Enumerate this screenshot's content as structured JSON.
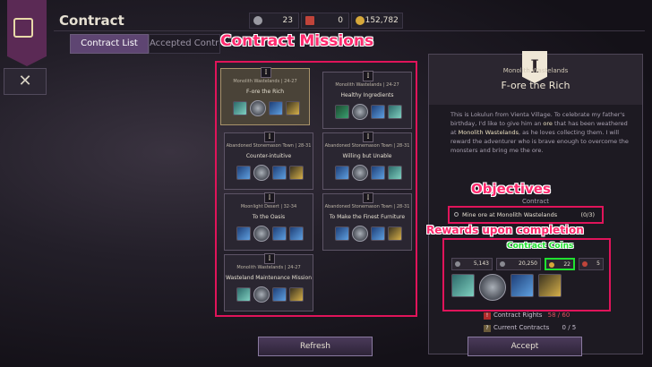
{
  "app": {
    "title": "Contract"
  },
  "currencies": [
    {
      "icon": "silver-coin-icon",
      "value": "23"
    },
    {
      "icon": "arrow-token-icon",
      "value": "0"
    },
    {
      "icon": "gold-coin-icon",
      "value": "5,152,782"
    }
  ],
  "tabs": [
    {
      "label": "Contract List",
      "active": true
    },
    {
      "label": "Accepted Contracts",
      "active": false
    }
  ],
  "annotations": {
    "missions": "Contract Missions",
    "objectives": "Objectives",
    "rewards": "Rewards upon completion",
    "coins": "Contract Coins"
  },
  "missions": [
    {
      "rank": "I",
      "region": "Monolith Wastelands",
      "level": "24-27",
      "title": "F-ore the Rich",
      "selected": true
    },
    {
      "rank": "I",
      "region": "Monolith Wastelands",
      "level": "24-27",
      "title": "Healthy Ingredients",
      "selected": false
    },
    {
      "rank": "I",
      "region": "Abandoned Stonemason Town",
      "level": "28-31",
      "title": "Counter-intuitive",
      "selected": false
    },
    {
      "rank": "I",
      "region": "Abandoned Stonemason Town",
      "level": "28-31",
      "title": "Willing but Unable",
      "selected": false
    },
    {
      "rank": "I",
      "region": "Moonlight Desert",
      "level": "32-34",
      "title": "To the Oasis",
      "selected": false
    },
    {
      "rank": "I",
      "region": "Abandoned Stonemason Town",
      "level": "28-31",
      "title": "To Make the Finest Furniture",
      "selected": false
    },
    {
      "rank": "I",
      "region": "Monolith Wastelands",
      "level": "24-27",
      "title": "Wasteland Maintenance Mission",
      "selected": false
    }
  ],
  "detail": {
    "rank": "I",
    "region": "Monolith Wastelands",
    "title": "F-ore the Rich",
    "desc_1": "This is Lokulun from Vienta Village. To celebrate my father's birthday, I'd like to give him an ",
    "desc_ore": "ore",
    "desc_2": " that has been weathered at ",
    "desc_place": "Monolith Wastelands",
    "desc_3": ", as he loves collecting them. I will reward the adventurer who is brave enough to overcome the monsters and bring me the ore.",
    "contract_label": "Contract",
    "objective": "Mine ore at Monolith Wastelands",
    "objective_count": "(0/3)",
    "rewards_label": "Co",
    "rewards": [
      {
        "icon": "exp-icon",
        "value": "5,143"
      },
      {
        "icon": "silver-icon",
        "value": "20,250"
      },
      {
        "icon": "contract-coin-icon",
        "value": "22"
      },
      {
        "icon": "token-icon",
        "value": "5"
      }
    ],
    "reward_items": [
      "gem-shard-icon",
      "silver-orb-icon",
      "water-drop-icon",
      "gold-pouch-icon"
    ],
    "rights_label": "Contract Rights",
    "rights_value": "58 / 60",
    "current_label": "Current Contracts",
    "current_value": "0 / 5"
  },
  "buttons": {
    "refresh": "Refresh",
    "accept": "Accept"
  }
}
